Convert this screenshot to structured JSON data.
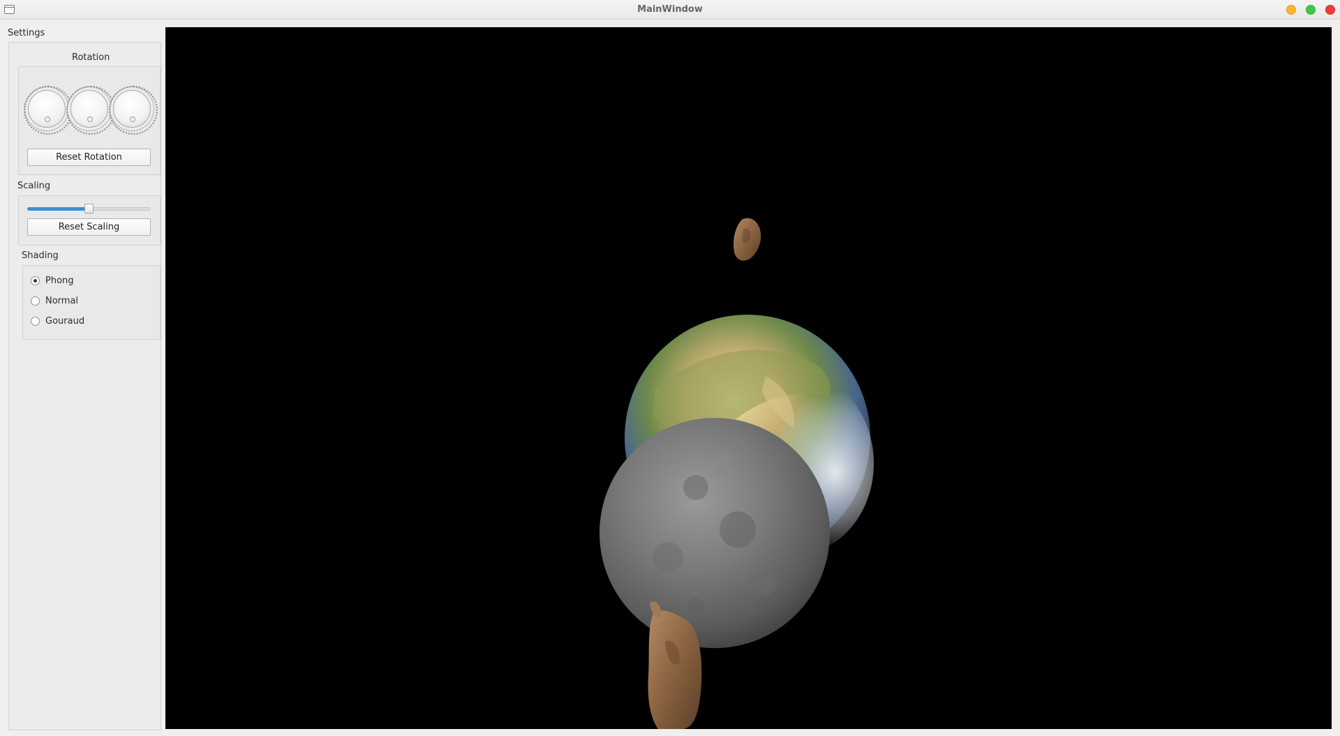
{
  "window": {
    "title": "MainWindow"
  },
  "settings": {
    "title": "Settings",
    "rotation": {
      "title": "Rotation",
      "dials": [
        "x-rotation-dial",
        "y-rotation-dial",
        "z-rotation-dial"
      ],
      "reset_label": "Reset Rotation"
    },
    "scaling": {
      "title": "Scaling",
      "slider_value": 0.5,
      "reset_label": "Reset Scaling"
    },
    "shading": {
      "title": "Shading",
      "options": [
        {
          "label": "Phong",
          "checked": true
        },
        {
          "label": "Normal",
          "checked": false
        },
        {
          "label": "Gouraud",
          "checked": false
        }
      ]
    }
  },
  "colors": {
    "viewport_bg": "#000000",
    "slider_accent": "#3c8fd8"
  },
  "scene": {
    "objects": [
      "earth",
      "moon",
      "asteroid",
      "asteroid"
    ]
  }
}
